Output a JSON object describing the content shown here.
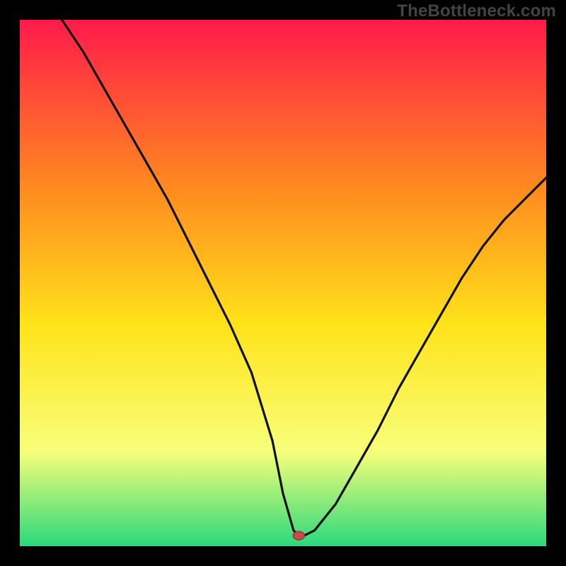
{
  "watermark": "TheBottleneck.com",
  "chart_data": {
    "type": "line",
    "title": "",
    "xlabel": "",
    "ylabel": "",
    "xlim": [
      0,
      100
    ],
    "ylim": [
      0,
      100
    ],
    "grid": false,
    "legend": false,
    "gradient_colors": {
      "top": "#ff1a4a",
      "mid_upper": "#ff8a1f",
      "mid": "#ffe31a",
      "mid_lower": "#f7ff7a",
      "bottom": "#2bd97c"
    },
    "curve_color": "#111111",
    "marker": {
      "x": 53,
      "y": 2,
      "color_fill": "#c94a4a",
      "color_stroke": "#9a3636"
    },
    "series": [
      {
        "name": "bottleneck-curve",
        "x": [
          8,
          12,
          16,
          20,
          24,
          28,
          32,
          36,
          40,
          44,
          48,
          50,
          52,
          53,
          54,
          56,
          60,
          64,
          68,
          72,
          76,
          80,
          84,
          88,
          92,
          96,
          100
        ],
        "y": [
          100,
          94,
          87,
          80,
          73,
          66,
          58,
          50,
          42,
          33,
          20,
          10,
          3,
          2,
          2,
          3,
          8,
          15,
          22,
          30,
          37,
          44,
          51,
          57,
          62,
          66,
          70
        ]
      }
    ]
  }
}
